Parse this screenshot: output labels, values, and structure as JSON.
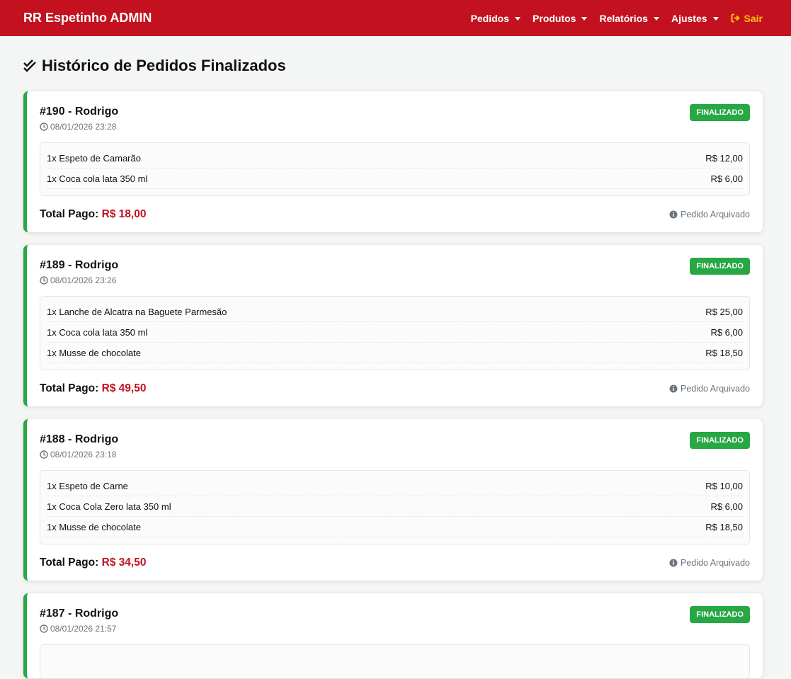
{
  "navbar": {
    "brand": "RR Espetinho ADMIN",
    "menu": [
      {
        "label": "Pedidos",
        "icon": "caret-down-icon"
      },
      {
        "label": "Produtos",
        "icon": "caret-down-icon"
      },
      {
        "label": "Relatórios",
        "icon": "caret-down-icon"
      },
      {
        "label": "Ajustes",
        "icon": "caret-down-icon"
      }
    ],
    "logout_label": "Sair",
    "logout_icon": "sign-out-icon"
  },
  "page": {
    "title": "Histórico de Pedidos Finalizados",
    "title_icon": "double-check-icon"
  },
  "labels": {
    "total_label": "Total Pago:",
    "archived": "Pedido Arquivado"
  },
  "colors": {
    "brand": "#c3111f",
    "success": "#28a745",
    "logout": "#ffc107"
  },
  "orders": [
    {
      "title": "#190 - Rodrigo",
      "time": "08/01/2026 23:28",
      "status": "FINALIZADO",
      "items": [
        {
          "name": "1x Espeto de Camarão",
          "price": "R$ 12,00"
        },
        {
          "name": "1x Coca cola lata 350 ml",
          "price": "R$ 6,00"
        }
      ],
      "total": "R$ 18,00"
    },
    {
      "title": "#189 - Rodrigo",
      "time": "08/01/2026 23:26",
      "status": "FINALIZADO",
      "items": [
        {
          "name": "1x Lanche de Alcatra na Baguete Parmesão",
          "price": "R$ 25,00"
        },
        {
          "name": "1x Coca cola lata 350 ml",
          "price": "R$ 6,00"
        },
        {
          "name": "1x Musse de chocolate",
          "price": "R$ 18,50"
        }
      ],
      "total": "R$ 49,50"
    },
    {
      "title": "#188 - Rodrigo",
      "time": "08/01/2026 23:18",
      "status": "FINALIZADO",
      "items": [
        {
          "name": "1x Espeto de Carne",
          "price": "R$ 10,00"
        },
        {
          "name": "1x Coca Cola Zero lata 350 ml",
          "price": "R$ 6,00"
        },
        {
          "name": "1x Musse de chocolate",
          "price": "R$ 18,50"
        }
      ],
      "total": "R$ 34,50"
    },
    {
      "title": "#187 - Rodrigo",
      "time": "08/01/2026 21:57",
      "status": "FINALIZADO",
      "items": [],
      "total": ""
    }
  ]
}
